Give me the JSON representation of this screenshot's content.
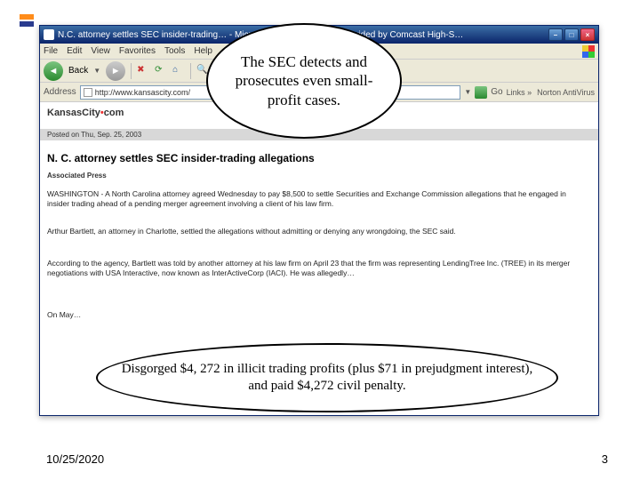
{
  "browser": {
    "title": "N.C. attorney settles SEC insider-trading… - Microsoft Internet Explorer provided by Comcast High-S…",
    "menus": {
      "file": "File",
      "edit": "Edit",
      "view": "View",
      "favorites": "Favorites",
      "tools": "Tools",
      "help": "Help"
    },
    "toolbar": {
      "back": "Back"
    },
    "addressbar": {
      "label": "Address",
      "url": "http://www.kansascity.com/",
      "go": "Go",
      "links": "Links »",
      "norton": "Norton AntiVirus"
    }
  },
  "article": {
    "site": {
      "left": "KansasCity",
      "dot": "•",
      "right": "com"
    },
    "posted": "Posted on Thu, Sep. 25, 2003",
    "headline": "N. C. attorney settles SEC insider-trading allegations",
    "byline": "Associated Press",
    "p1": "WASHINGTON - A North Carolina attorney agreed Wednesday to pay $8,500 to settle Securities and Exchange Commission allegations that he engaged in insider trading ahead of a pending merger agreement involving a client of his law firm.",
    "p2": "Arthur Bartlett, an attorney in Charlotte, settled the allegations without admitting or denying any wrongdoing, the SEC said.",
    "p3": "According to the agency, Bartlett was told by another attorney at his law firm on April 23 that the firm was representing LendingTree Inc. (TREE) in its merger negotiations with USA Interactive, now known as InterActiveCorp (IACI). He was allegedly…",
    "p4": "On May…"
  },
  "callouts": {
    "top": "The SEC detects and prosecutes even small-profit cases.",
    "bottom": "Disgorged $4, 272 in illicit trading profits (plus $71 in prejudgment interest), and paid $4,272 civil penalty."
  },
  "slide": {
    "date": "10/25/2020",
    "number": "3"
  }
}
